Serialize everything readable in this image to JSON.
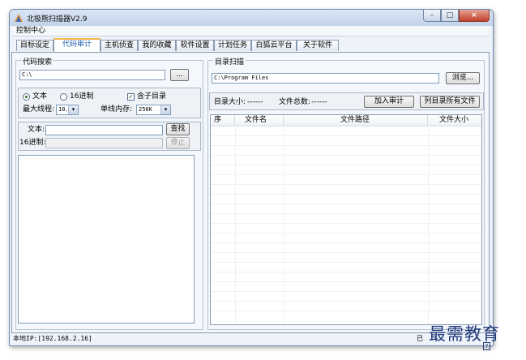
{
  "window": {
    "title": "北极熊扫描器V2.9"
  },
  "menu": {
    "control_center": "控制中心"
  },
  "tabs": [
    {
      "label": "目标设定"
    },
    {
      "label": "代码审计"
    },
    {
      "label": "主机侦查"
    },
    {
      "label": "我的收藏"
    },
    {
      "label": "软件设置"
    },
    {
      "label": "计划任务"
    },
    {
      "label": "白狐云平台"
    },
    {
      "label": "关于软件"
    }
  ],
  "code_search": {
    "title": "代码搜索",
    "path_value": "C:\\",
    "browse_button": "...",
    "radio_text": "文本",
    "radio_hex": "16进制",
    "include_subdir": "含子目录",
    "max_threads_label": "最大线程:",
    "max_threads_value": "10...",
    "single_thread_memory_label": "单线内存:",
    "single_thread_memory_value": "256K",
    "text_label": "文本:",
    "text_value": "",
    "hex_label": "16进制:",
    "hex_value": "",
    "find_button": "查找",
    "stop_button": "停止"
  },
  "dir_scan": {
    "title": "目录扫描",
    "path_value": "C:\\Program Files",
    "browse_button": "浏览...",
    "dir_size_label": "目录大小:",
    "dir_size_value": "------",
    "total_files_label": "文件总数:",
    "total_files_value": "------",
    "add_audit_button": "加入审计",
    "list_all_button": "列目录所有文件",
    "columns": [
      "序",
      "文件名",
      "文件路径",
      "文件大小"
    ]
  },
  "status": {
    "local_ip": "本地IP:[192.168.2.16]",
    "right_text": "已"
  },
  "watermark": {
    "text": "最需教育",
    "sub": "?"
  }
}
